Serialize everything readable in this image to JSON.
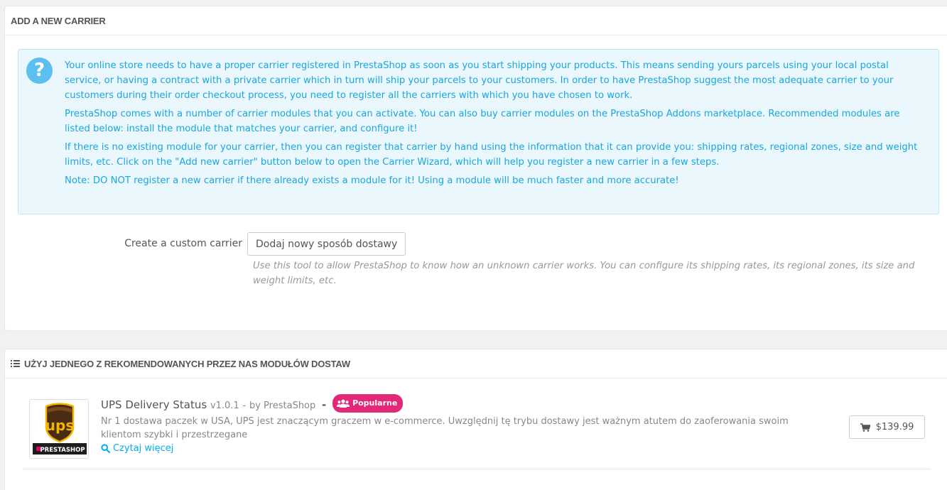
{
  "add_panel": {
    "title": "ADD A NEW CARRIER",
    "info_paragraphs": [
      "Your online store needs to have a proper carrier registered in PrestaShop as soon as you start shipping your products. This means sending yours parcels using your local postal service, or having a contract with a private carrier which in turn will ship your parcels to your customers. In order to have PrestaShop suggest the most adequate carrier to your customers during their order checkout process, you need to register all the carriers with which you have chosen to work.",
      "PrestaShop comes with a number of carrier modules that you can activate. You can also buy carrier modules on the PrestaShop Addons marketplace. Recommended modules are listed below: install the module that matches your carrier, and configure it!",
      "If there is no existing module for your carrier, then you can register that carrier by hand using the information that it can provide you: shipping rates, regional zones, size and weight limits, etc. Click on the \"Add new carrier\" button below to open the Carrier Wizard, which will help you register a new carrier in a few steps.",
      "Note: DO NOT register a new carrier if there already exists a module for it! Using a module will be much faster and more accurate!"
    ],
    "custom_carrier_label": "Create a custom carrier",
    "add_button_label": "Dodaj nowy sposób dostawy",
    "help_text": "Use this tool to allow PrestaShop to know how an unknown carrier works. You can configure its shipping rates, its regional zones, its size and weight limits, etc."
  },
  "modules_panel": {
    "title": "UŻYJ JEDNEGO Z REKOMENDOWANYCH PRZEZ NAS MODUŁÓW DOSTAW",
    "modules": [
      {
        "name": "UPS Delivery Status",
        "version": "v1.0.1",
        "author": "by PrestaShop",
        "badge": "Popularne",
        "description": "Nr 1 dostawa paczek w USA, UPS jest znaczącym graczem w e-commerce. Uwzględnij tę trybu dostawy jest ważnym atutem do zaoferowania swoim klientom szybki i przestrzegane",
        "read_more": "Czytaj więcej",
        "price": "$139.99",
        "logo_text": "ups",
        "logo_caption": "PRESTASHOP"
      }
    ]
  },
  "colors": {
    "info_text": "#1ba6df",
    "info_bg": "#eaf7fd",
    "badge": "#e3287a",
    "link": "#00aff0"
  }
}
